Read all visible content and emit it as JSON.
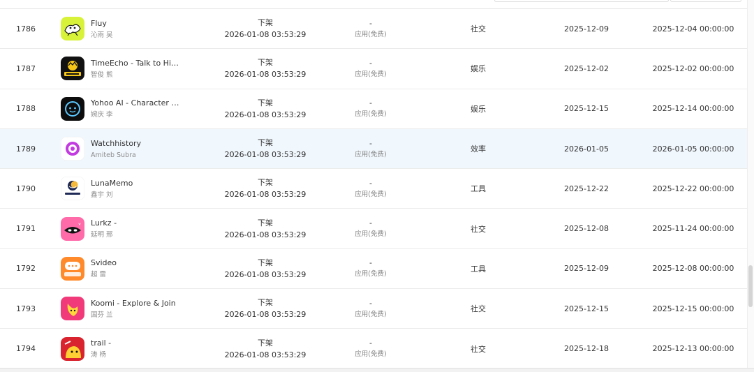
{
  "colors": {
    "hover_row": "#f0f7fd",
    "border": "#ebebeb",
    "muted_text": "#8c8c8c"
  },
  "rows": [
    {
      "id": "1786",
      "icon": "fluy-app-icon",
      "name": "Fluy",
      "developer": "沁雨 吴",
      "status": "下架",
      "status_time": "2026-01-08 03:53:29",
      "price": "-",
      "price_type": "应用(免费)",
      "category": "社交",
      "date": "2025-12-09",
      "release": "2025-12-04 00:00:00"
    },
    {
      "id": "1787",
      "icon": "timeecho-app-icon",
      "name": "TimeEcho - Talk to Hist…",
      "developer": "智俊 熊",
      "status": "下架",
      "status_time": "2026-01-08 03:53:29",
      "price": "-",
      "price_type": "应用(免费)",
      "category": "娱乐",
      "date": "2025-12-02",
      "release": "2025-12-02 00:00:00"
    },
    {
      "id": "1788",
      "icon": "yohoo-app-icon",
      "name": "Yohoo AI - Character C…",
      "developer": "婉庆 李",
      "status": "下架",
      "status_time": "2026-01-08 03:53:29",
      "price": "-",
      "price_type": "应用(免费)",
      "category": "娱乐",
      "date": "2025-12-15",
      "release": "2025-12-14 00:00:00"
    },
    {
      "id": "1789",
      "icon": "watchhistory-app-icon",
      "name": "Watchhistory",
      "developer": "Amiteb Subra",
      "status": "下架",
      "status_time": "2026-01-08 03:53:29",
      "price": "-",
      "price_type": "应用(免费)",
      "category": "效率",
      "date": "2026-01-05",
      "release": "2026-01-05 00:00:00",
      "hover": true
    },
    {
      "id": "1790",
      "icon": "lunamemo-app-icon",
      "name": "LunaMemo",
      "developer": "鑫宇 刘",
      "status": "下架",
      "status_time": "2026-01-08 03:53:29",
      "price": "-",
      "price_type": "应用(免费)",
      "category": "工具",
      "date": "2025-12-22",
      "release": "2025-12-22 00:00:00"
    },
    {
      "id": "1791",
      "icon": "lurkz-app-icon",
      "name": "Lurkz -",
      "developer": "延明 邢",
      "status": "下架",
      "status_time": "2026-01-08 03:53:29",
      "price": "-",
      "price_type": "应用(免费)",
      "category": "社交",
      "date": "2025-12-08",
      "release": "2025-11-24 00:00:00"
    },
    {
      "id": "1792",
      "icon": "svideo-app-icon",
      "name": "Svideo",
      "developer": "超 雷",
      "status": "下架",
      "status_time": "2026-01-08 03:53:29",
      "price": "-",
      "price_type": "应用(免费)",
      "category": "工具",
      "date": "2025-12-09",
      "release": "2025-12-08 00:00:00"
    },
    {
      "id": "1793",
      "icon": "koomi-app-icon",
      "name": "Koomi - Explore & Join",
      "developer": "国芬 兰",
      "status": "下架",
      "status_time": "2026-01-08 03:53:29",
      "price": "-",
      "price_type": "应用(免费)",
      "category": "社交",
      "date": "2025-12-15",
      "release": "2025-12-15 00:00:00"
    },
    {
      "id": "1794",
      "icon": "trail-app-icon",
      "name": "trail -",
      "developer": "涛 杨",
      "status": "下架",
      "status_time": "2026-01-08 03:53:29",
      "price": "-",
      "price_type": "应用(免费)",
      "category": "社交",
      "date": "2025-12-18",
      "release": "2025-12-13 00:00:00"
    }
  ]
}
